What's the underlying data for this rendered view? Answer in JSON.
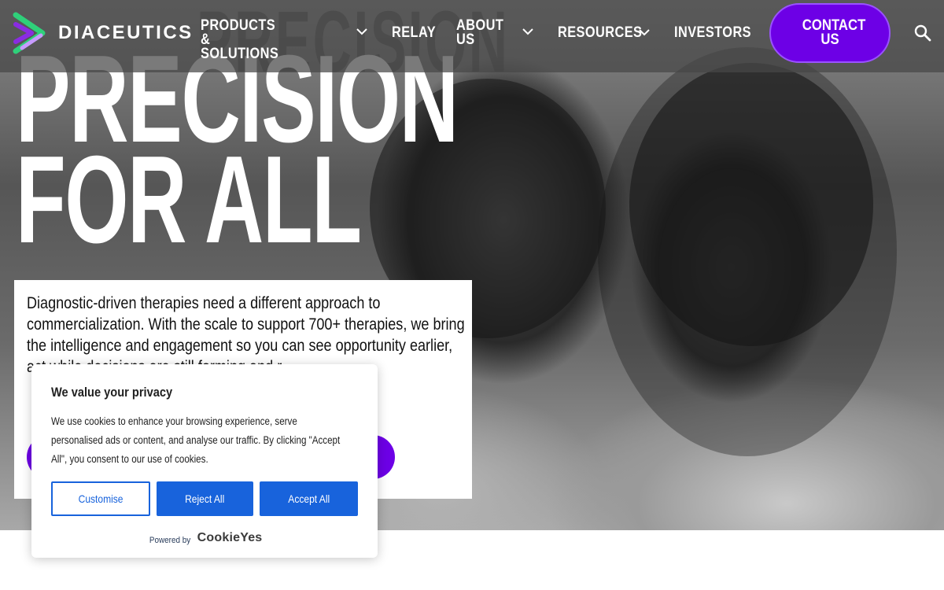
{
  "brand": {
    "name": "DIACEUTICS",
    "colors": {
      "accent": "#6d00e6",
      "logo_green": "#2fd07a",
      "logo_purple": "#8a2be2",
      "cookie_blue": "#1863dc"
    }
  },
  "nav": {
    "items": [
      {
        "label": "PRODUCTS & SOLUTIONS",
        "has_dropdown": true
      },
      {
        "label": "RELAY",
        "has_dropdown": false
      },
      {
        "label": "ABOUT US",
        "has_dropdown": true
      },
      {
        "label": "RESOURCES",
        "has_dropdown": true
      },
      {
        "label": "INVESTORS",
        "has_dropdown": false
      }
    ],
    "contact_label": "CONTACT US",
    "search_icon": "search-icon"
  },
  "hero": {
    "bg_text": "PRECISION",
    "heading_line1": "PRECISION",
    "heading_line2": "FOR ALL"
  },
  "intro": {
    "text": "Diagnostic-driven therapies need a different approach to commercialization. With the scale to support 700+ therapies, we bring the intelligence and engagement so you can see opportunity earlier, act while decisions are still forming and r"
  },
  "cookie_banner": {
    "title": "We value your privacy",
    "body": "We use cookies to enhance your browsing experience, serve personalised ads or content, and analyse our traffic. By clicking \"Accept All\", you consent to our use of cookies.",
    "buttons": {
      "customise": "Customise",
      "reject": "Reject All",
      "accept": "Accept All"
    },
    "powered_by": "Powered by",
    "provider": "CookieYes"
  }
}
